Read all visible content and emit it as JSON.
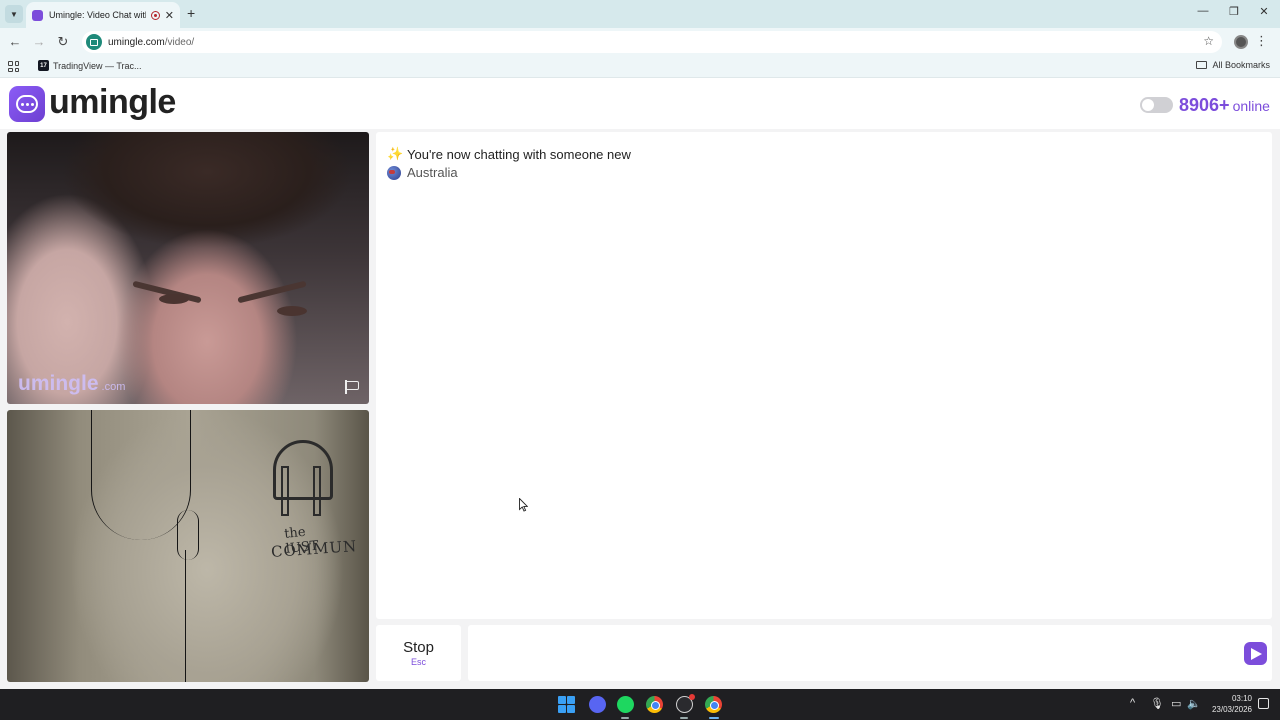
{
  "browser": {
    "tab_title": "Umingle: Video Chat with S",
    "url_host": "umingle.com",
    "url_path": "/video/",
    "bookmark_tradingview": "TradingView — Trac...",
    "all_bookmarks": "All Bookmarks",
    "new_tab_glyph": "+",
    "close_glyph": "✕",
    "minimize_glyph": "—",
    "restore_glyph": "❐",
    "back_glyph": "←",
    "forward_glyph": "→",
    "reload_glyph": "↻",
    "star_glyph": "☆",
    "menu_glyph": "⋮",
    "tv_logo_text": "17"
  },
  "site": {
    "logo_text": "umingle",
    "online_count": "8906+",
    "online_label": "online",
    "accent_color": "#7c4ddb"
  },
  "video": {
    "watermark": "umingle",
    "watermark_suffix": ".com",
    "print_line1": "the lUST",
    "print_line2": "COMMUN"
  },
  "chat": {
    "notice": "You're now chatting with someone new",
    "notice_icon": "sparkle-icon",
    "country": "Australia",
    "country_icon": "globe-flag-icon",
    "sparkle_glyph": "✨",
    "stop_label": "Stop",
    "stop_shortcut": "Esc",
    "message_placeholder": ""
  },
  "taskbar": {
    "time": "03:10",
    "date": "23/03/2026",
    "tray_up_glyph": "^",
    "tray_mic_glyph": "🎙",
    "tray_net_glyph": "▭",
    "tray_vol_glyph": "🔈"
  }
}
